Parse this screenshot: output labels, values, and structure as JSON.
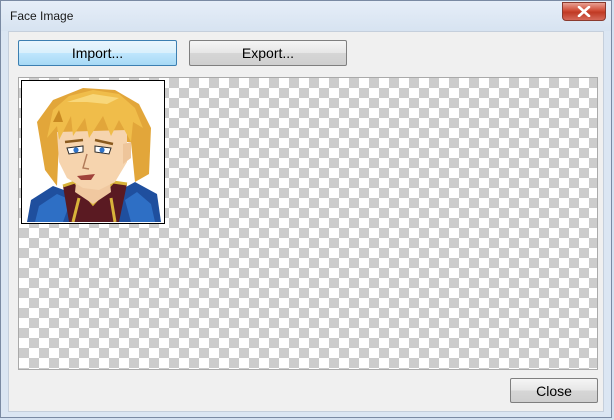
{
  "window": {
    "title": "Face Image"
  },
  "toolbar": {
    "import_label": "Import...",
    "export_label": "Export..."
  },
  "footer": {
    "close_label": "Close"
  },
  "colors": {
    "checker_light": "#ffffff",
    "checker_dark": "#cccccc",
    "close_button_red": "#c7422c",
    "focused_button": "#bee6fd"
  },
  "icons": {
    "window_close": "close-icon"
  }
}
